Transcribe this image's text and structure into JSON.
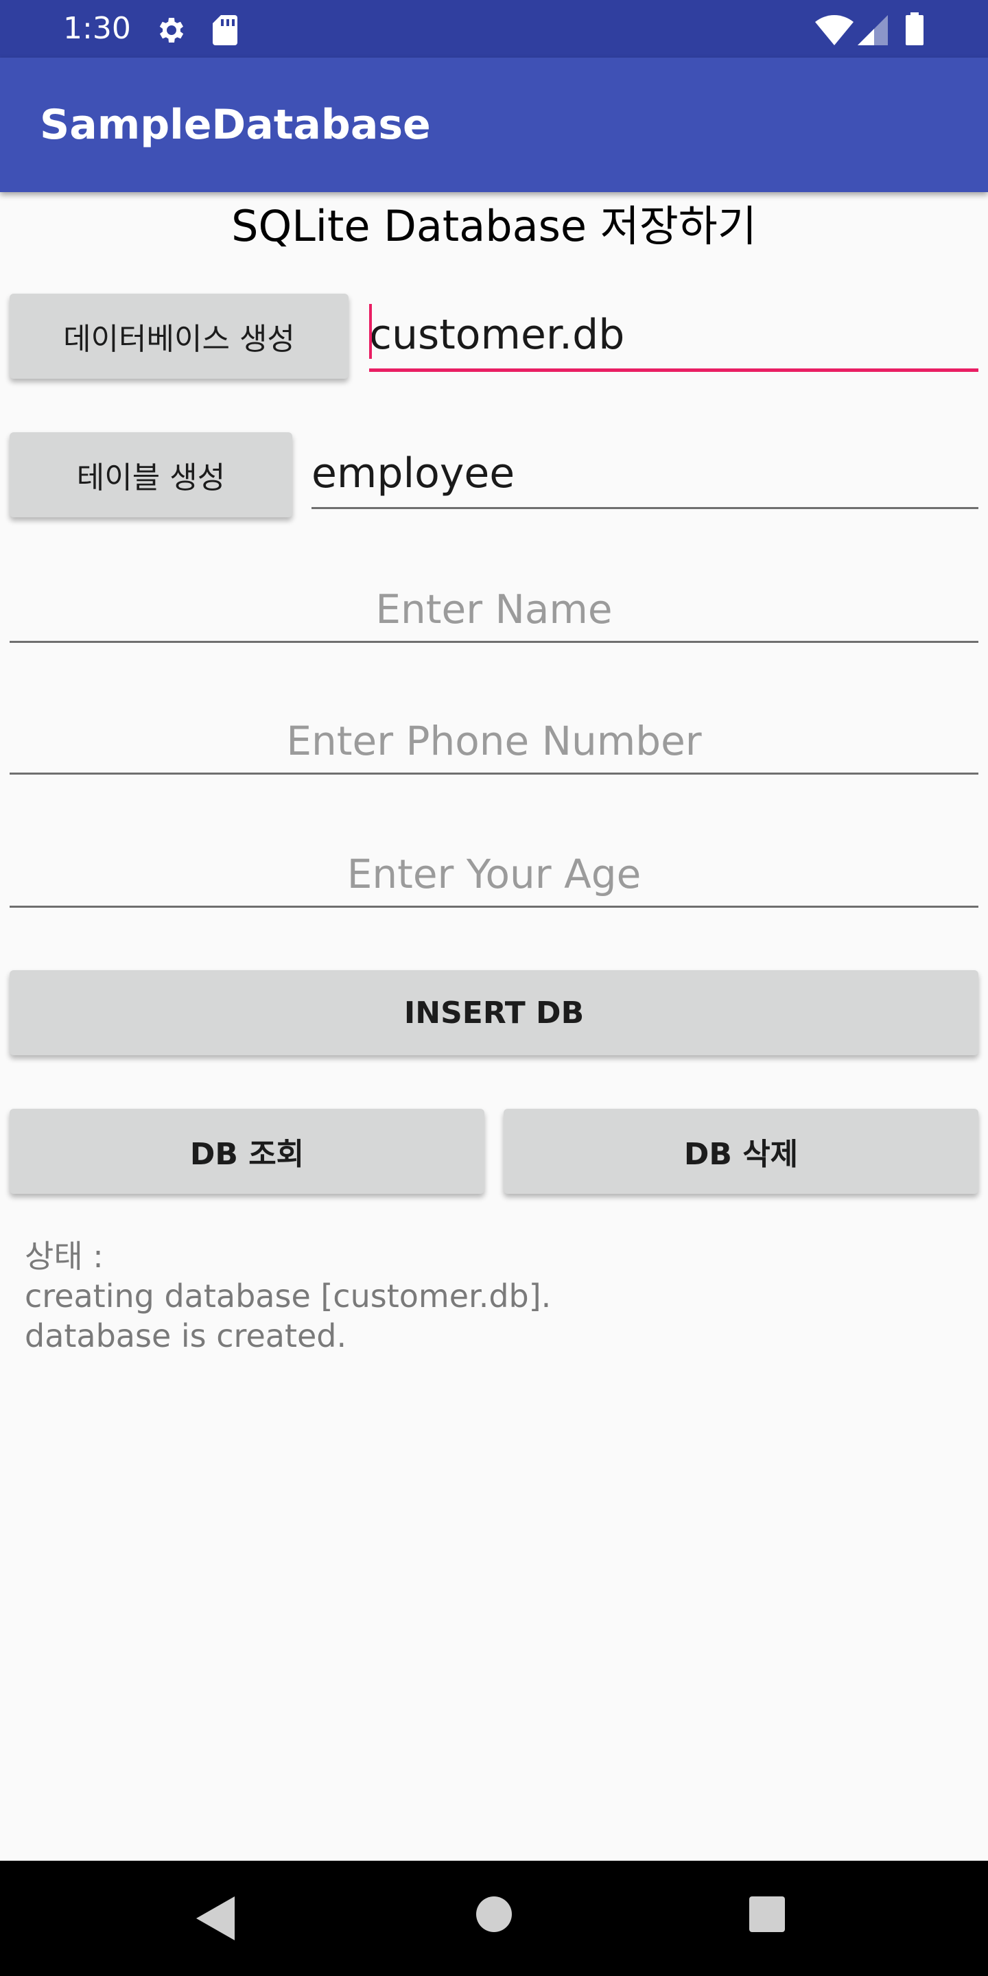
{
  "status_bar": {
    "time": "1:30",
    "icons": [
      "gear-icon",
      "sd-card-icon",
      "wifi-icon",
      "signal-icon",
      "battery-icon"
    ]
  },
  "app_bar": {
    "title": "SampleDatabase"
  },
  "page": {
    "title": "SQLite Database 저장하기"
  },
  "database": {
    "button_label": "데이터베이스 생성",
    "name_value": "customer.db"
  },
  "table": {
    "button_label": "테이블 생성",
    "name_value": "employee"
  },
  "form": {
    "name_placeholder": "Enter Name",
    "phone_placeholder": "Enter Phone Number",
    "age_placeholder": "Enter Your Age"
  },
  "actions": {
    "insert_label": "INSERT DB",
    "query_label": "DB 조회",
    "delete_label": "DB 삭제"
  },
  "status": {
    "lines": [
      "상태 :",
      "creating database [customer.db].",
      "database is created."
    ]
  },
  "colors": {
    "status_bar": "#303f9f",
    "app_bar": "#3f51b5",
    "accent": "#e91e63",
    "button": "#d6d7d7"
  },
  "nav_bar": {
    "icons": [
      "back-icon",
      "home-icon",
      "recents-icon"
    ]
  }
}
